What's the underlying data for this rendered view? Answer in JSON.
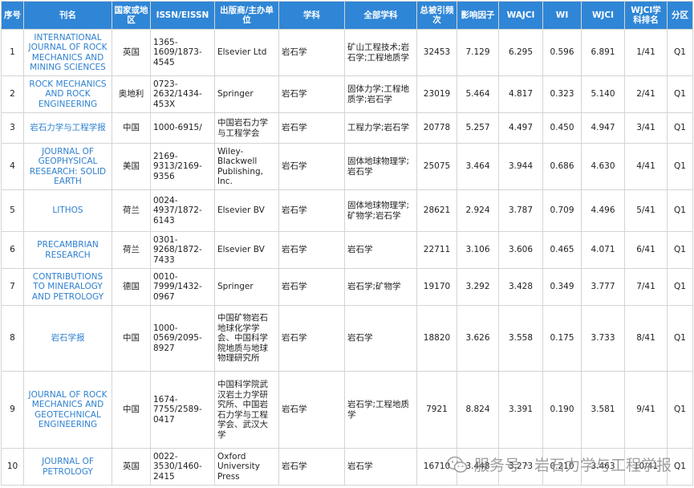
{
  "headers": [
    "序号",
    "刊名",
    "国家或地区",
    "ISSN/EISSN",
    "出版商/主办单位",
    "学科",
    "全部学科",
    "总被引频次",
    "影响因子",
    "WAJCI",
    "WI",
    "WJCI",
    "WJCI学科排名",
    "分区"
  ],
  "rows": [
    {
      "no": "1",
      "name": "INTERNATIONAL JOURNAL OF ROCK MECHANICS AND MINING SCIENCES",
      "country": "英国",
      "issn": "1365-1609/1873-4545",
      "publisher": "Elsevier Ltd",
      "subject": "岩石学",
      "all": "矿山工程技术;岩石学;工程地质学",
      "cites": "32453",
      "if": "7.129",
      "wajci": "6.295",
      "wi": "0.596",
      "wjci": "6.891",
      "rank": "1/41",
      "q": "Q1"
    },
    {
      "no": "2",
      "name": "ROCK MECHANICS AND ROCK ENGINEERING",
      "country": "奥地利",
      "issn": "0723-2632/1434-453X",
      "publisher": "Springer",
      "subject": "岩石学",
      "all": "固体力学;工程地质学;岩石学",
      "cites": "23019",
      "if": "5.464",
      "wajci": "4.817",
      "wi": "0.323",
      "wjci": "5.140",
      "rank": "2/41",
      "q": "Q1"
    },
    {
      "no": "3",
      "name": "岩石力学与工程学报",
      "country": "中国",
      "issn": "1000-6915/",
      "publisher": "中国岩石力学与工程学会",
      "subject": "岩石学",
      "all": "工程力学;岩石学",
      "cites": "20778",
      "if": "5.257",
      "wajci": "4.497",
      "wi": "0.450",
      "wjci": "4.947",
      "rank": "3/41",
      "q": "Q1"
    },
    {
      "no": "4",
      "name": "JOURNAL OF GEOPHYSICAL RESEARCH: SOLID EARTH",
      "country": "美国",
      "issn": "2169-9313/2169-9356",
      "publisher": "Wiley-Blackwell Publishing, Inc.",
      "subject": "岩石学",
      "all": "固体地球物理学;岩石学",
      "cites": "25075",
      "if": "3.464",
      "wajci": "3.944",
      "wi": "0.686",
      "wjci": "4.630",
      "rank": "4/41",
      "q": "Q1"
    },
    {
      "no": "5",
      "name": "LITHOS",
      "country": "荷兰",
      "issn": "0024-4937/1872-6143",
      "publisher": "Elsevier BV",
      "subject": "岩石学",
      "all": "固体地球物理学;矿物学;岩石学",
      "cites": "28621",
      "if": "2.924",
      "wajci": "3.787",
      "wi": "0.709",
      "wjci": "4.496",
      "rank": "5/41",
      "q": "Q1"
    },
    {
      "no": "6",
      "name": "PRECAMBRIAN RESEARCH",
      "country": "荷兰",
      "issn": "0301-9268/1872-7433",
      "publisher": "Elsevier BV",
      "subject": "岩石学",
      "all": "岩石学",
      "cites": "22711",
      "if": "3.106",
      "wajci": "3.606",
      "wi": "0.465",
      "wjci": "4.071",
      "rank": "6/41",
      "q": "Q1"
    },
    {
      "no": "7",
      "name": "CONTRIBUTIONS TO MINERALOGY AND PETROLOGY",
      "country": "德国",
      "issn": "0010-7999/1432-0967",
      "publisher": "Springer",
      "subject": "岩石学",
      "all": "岩石学;矿物学",
      "cites": "19170",
      "if": "3.292",
      "wajci": "3.428",
      "wi": "0.349",
      "wjci": "3.777",
      "rank": "7/41",
      "q": "Q1"
    },
    {
      "no": "8",
      "name": "岩石学报",
      "country": "中国",
      "issn": "1000-0569/2095-8927",
      "publisher": "中国矿物岩石地球化学学会、中国科学院地质与地球物理研究所",
      "subject": "岩石学",
      "all": "岩石学",
      "cites": "18820",
      "if": "3.626",
      "wajci": "3.558",
      "wi": "0.175",
      "wjci": "3.733",
      "rank": "8/41",
      "q": "Q1"
    },
    {
      "no": "9",
      "name": "JOURNAL OF ROCK MECHANICS AND GEOTECHNICAL ENGINEERING",
      "country": "中国",
      "issn": "1674-7755/2589-0417",
      "publisher": "中国科学院武汉岩土力学研究所、中国岩石力学与工程学会、武汉大学",
      "subject": "岩石学",
      "all": "岩石学;工程地质学",
      "cites": "7921",
      "if": "8.824",
      "wajci": "3.391",
      "wi": "0.190",
      "wjci": "3.581",
      "rank": "9/41",
      "q": "Q1"
    },
    {
      "no": "10",
      "name": "JOURNAL OF PETROLOGY",
      "country": "英国",
      "issn": "0022-3530/1460-2415",
      "publisher": "Oxford University Press",
      "subject": "岩石学",
      "all": "岩石学",
      "cites": "16710",
      "if": "3.448",
      "wajci": "3.273",
      "wi": "0.210",
      "wjci": "3.463",
      "rank": "10/41",
      "q": "Q1"
    }
  ],
  "watermark": {
    "text": "服务号 · 岩石力学与工程学报",
    "icon": "wechat-icon"
  },
  "colors": {
    "header_bg": "#2f86d6",
    "header_text": "#ffffff",
    "link": "#2f80d0",
    "border": "#d4d4d4"
  }
}
